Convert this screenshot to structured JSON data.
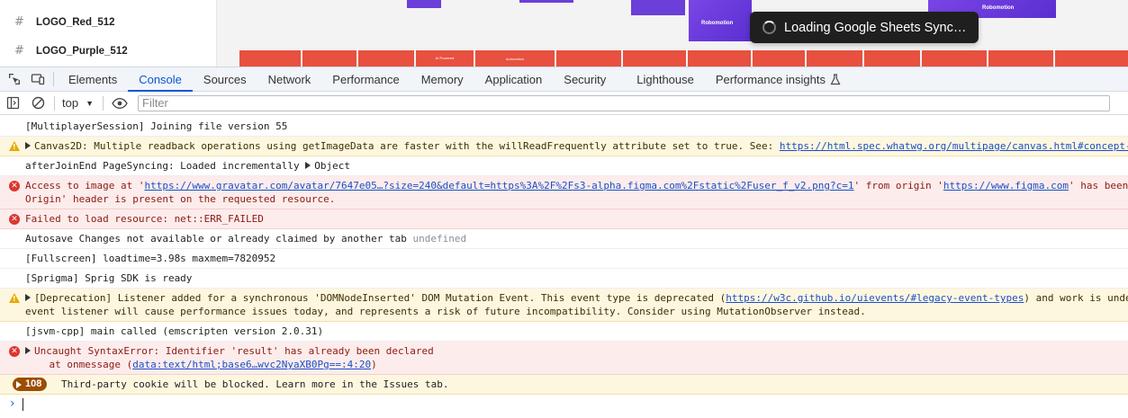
{
  "layers": [
    {
      "name": "LOGO_Red_512"
    },
    {
      "name": "LOGO_Purple_512"
    }
  ],
  "canvas": {
    "purple_label": "Robomotion",
    "red_strip_label_1": "AI Powered",
    "red_strip_label_2": "Automation"
  },
  "toast": {
    "text": "Loading Google Sheets Sync…"
  },
  "devtools": {
    "tabs": [
      {
        "label": "Elements",
        "active": false
      },
      {
        "label": "Console",
        "active": true
      },
      {
        "label": "Sources",
        "active": false
      },
      {
        "label": "Network",
        "active": false
      },
      {
        "label": "Performance",
        "active": false
      },
      {
        "label": "Memory",
        "active": false
      },
      {
        "label": "Application",
        "active": false
      },
      {
        "label": "Security",
        "active": false
      },
      {
        "label": "Lighthouse",
        "active": false
      },
      {
        "label": "Performance insights",
        "active": false
      }
    ],
    "context": "top",
    "filter_placeholder": "Filter"
  },
  "console": {
    "messages": [
      {
        "level": "info",
        "line1": "[MultiplayerSession] Joining file version 55"
      },
      {
        "level": "warning",
        "expandable": true,
        "line1": "Canvas2D: Multiple readback operations using getImageData are faster with the willReadFrequently attribute set to true. See: ",
        "link1": "https://html.spec.whatwg.org/multipage/canvas.html#concept-"
      },
      {
        "level": "info",
        "line1": "afterJoinEnd PageSyncing: Loaded incrementally ",
        "obj": "Object"
      },
      {
        "level": "error",
        "line1": "Access to image at '",
        "link1": "https://www.gravatar.com/avatar/7647e05…?size=240&default=https%3A%2F%2Fs3-alpha.figma.com%2Fstatic%2Fuser_f_v2.png?c=1",
        "mid": "' from origin '",
        "link2": "https://www.figma.com",
        "tail": "' has been",
        "line2": "Origin' header is present on the requested resource."
      },
      {
        "level": "error",
        "line1": "Failed to load resource: net::ERR_FAILED"
      },
      {
        "level": "info",
        "line1": "Autosave Changes not available or already claimed by another tab ",
        "muted": "undefined"
      },
      {
        "level": "info",
        "line1": "[Fullscreen] loadtime=3.98s maxmem=7820952"
      },
      {
        "level": "info",
        "line1": "[Sprigma] Sprig SDK is ready"
      },
      {
        "level": "warning",
        "expandable": true,
        "line1": "[Deprecation] Listener added for a synchronous 'DOMNodeInserted' DOM Mutation Event. This event type is deprecated (",
        "link1": "https://w3c.github.io/uievents/#legacy-event-types",
        "tail": ") and work is unde",
        "line2": "event listener will cause performance issues today, and represents a risk of future incompatibility. Consider using MutationObserver instead."
      },
      {
        "level": "info",
        "line1": "[jsvm-cpp] main called (emscripten version 2.0.31)"
      },
      {
        "level": "error",
        "expandable": true,
        "line1": "Uncaught SyntaxError: Identifier 'result' has already been declared",
        "line2_prefix": "at onmessage (",
        "link2": "data:text/html;base6…wvc2NyaXB0Pg==:4:20",
        "line2_suffix": ")"
      }
    ],
    "issues": {
      "count": "108",
      "text": "Third-party cookie will be blocked. Learn more in the Issues tab."
    }
  }
}
